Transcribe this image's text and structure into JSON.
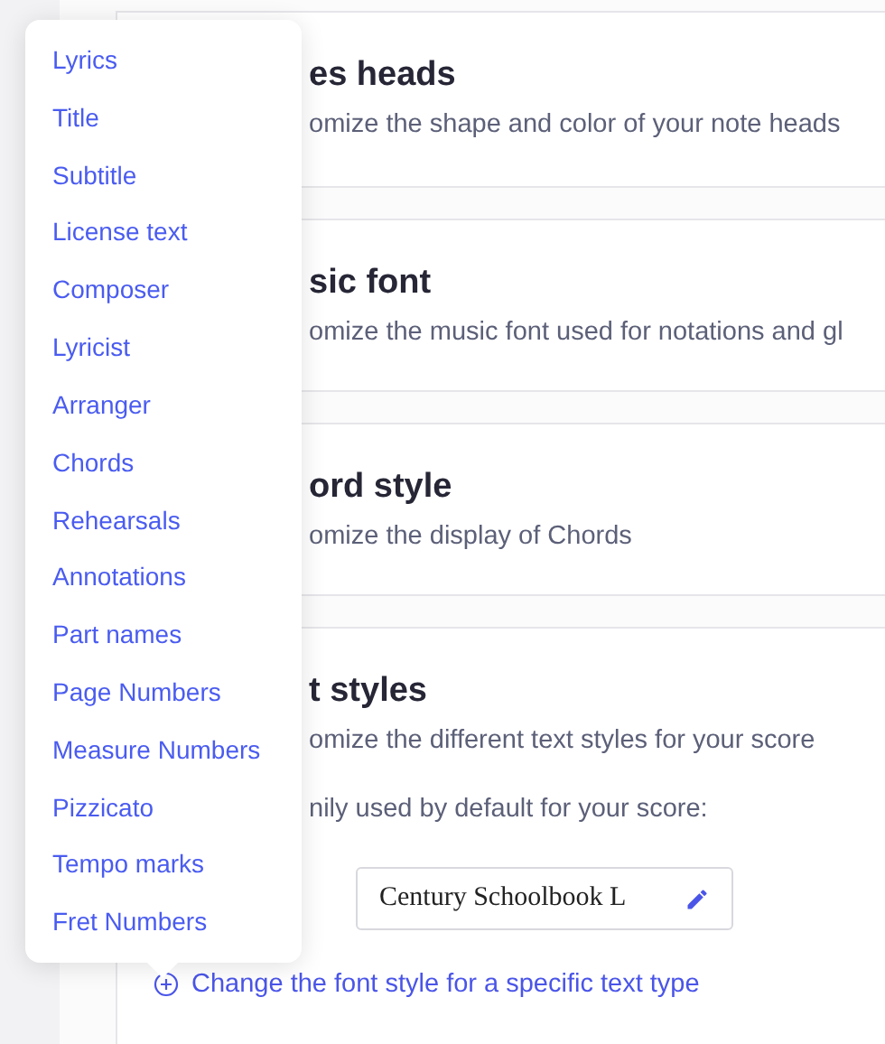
{
  "sections": [
    {
      "title": "es heads",
      "description": "omize the shape and color of your note heads"
    },
    {
      "title": "sic font",
      "description": "omize the music font used for notations and gl"
    },
    {
      "title": "ord style",
      "description": "omize the display of Chords"
    },
    {
      "title": "t styles",
      "description": "omize the different text styles for your score",
      "font_label": "nily used by default for your score:",
      "font_value": "Century Schoolbook L",
      "link": "Change the font style for a specific text type"
    }
  ],
  "menu": {
    "items": [
      {
        "label": "Lyrics"
      },
      {
        "label": "Title"
      },
      {
        "label": "Subtitle"
      },
      {
        "label": "License text"
      },
      {
        "label": "Composer"
      },
      {
        "label": "Lyricist"
      },
      {
        "label": "Arranger"
      },
      {
        "label": "Chords"
      },
      {
        "label": "Rehearsals"
      },
      {
        "label": "Annotations"
      },
      {
        "label": "Part names"
      },
      {
        "label": "Page Numbers"
      },
      {
        "label": "Measure Numbers"
      },
      {
        "label": "Pizzicato"
      },
      {
        "label": "Tempo marks"
      },
      {
        "label": "Fret Numbers"
      }
    ]
  }
}
